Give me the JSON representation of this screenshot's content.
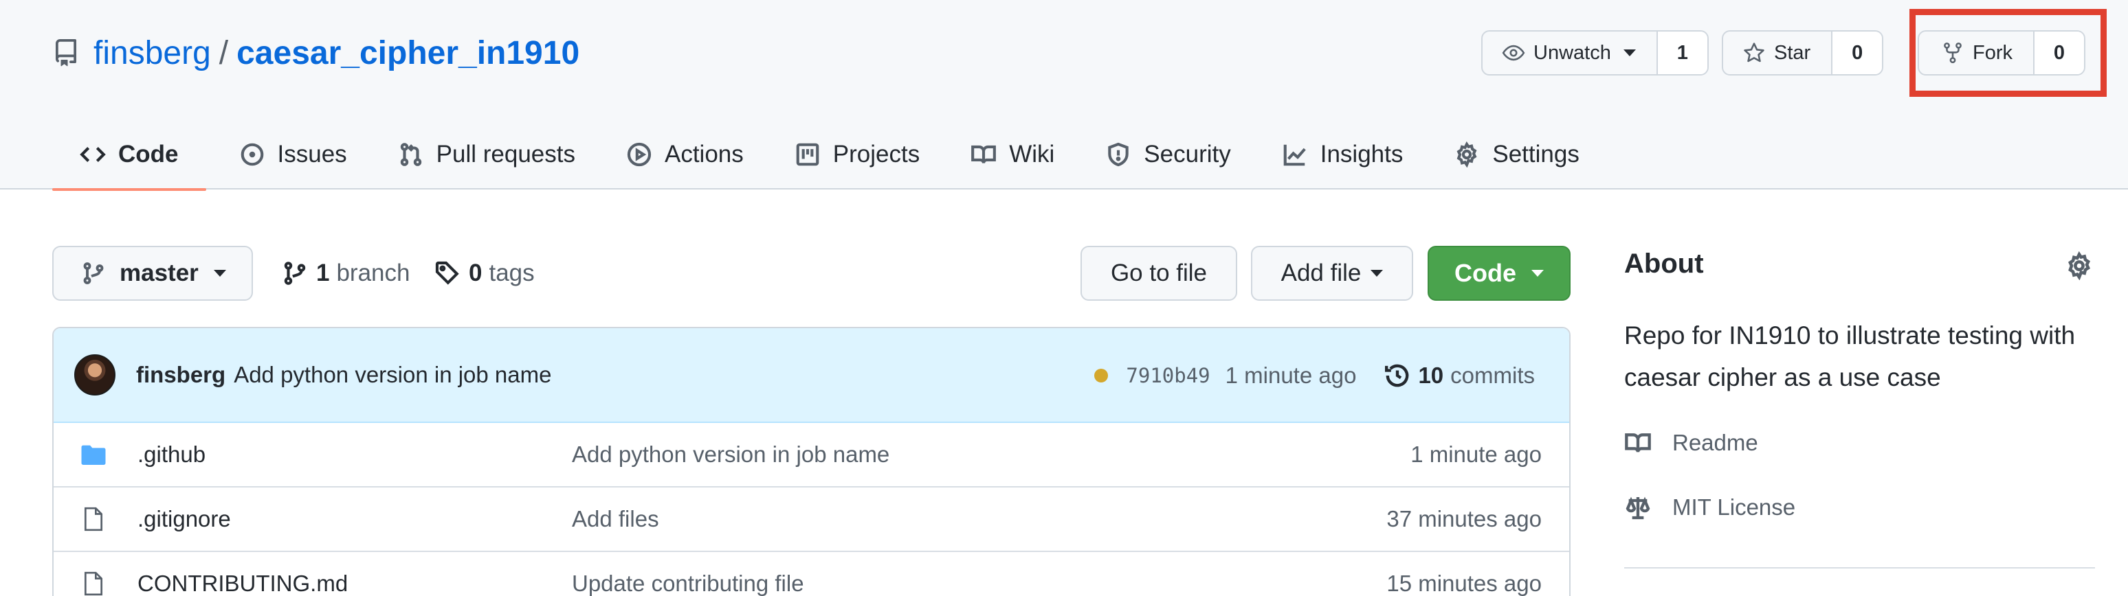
{
  "repo": {
    "owner": "finsberg",
    "separator": "/",
    "name": "caesar_cipher_in1910"
  },
  "header_actions": {
    "watch": {
      "label": "Unwatch",
      "count": "1"
    },
    "star": {
      "label": "Star",
      "count": "0"
    },
    "fork": {
      "label": "Fork",
      "count": "0"
    }
  },
  "highlight_color": "#e0402f",
  "tabs": [
    {
      "label": "Code",
      "icon": "code-icon",
      "selected": true
    },
    {
      "label": "Issues",
      "icon": "issue-icon"
    },
    {
      "label": "Pull requests",
      "icon": "pull-request-icon"
    },
    {
      "label": "Actions",
      "icon": "play-icon"
    },
    {
      "label": "Projects",
      "icon": "project-icon"
    },
    {
      "label": "Wiki",
      "icon": "book-icon"
    },
    {
      "label": "Security",
      "icon": "shield-icon"
    },
    {
      "label": "Insights",
      "icon": "graph-icon"
    },
    {
      "label": "Settings",
      "icon": "gear-icon"
    }
  ],
  "toolbar": {
    "branch": "master",
    "branch_count": "1",
    "branch_word": "branch",
    "tag_count": "0",
    "tag_word": "tags",
    "go_to_file": "Go to file",
    "add_file": "Add file",
    "code": "Code"
  },
  "latest_commit": {
    "author": "finsberg",
    "message": "Add python version in job name",
    "sha": "7910b49",
    "time": "1 minute ago",
    "commit_count": "10",
    "commit_word": "commits",
    "status_color": "#d4a72c"
  },
  "files": [
    {
      "name": ".github",
      "type": "folder",
      "message": "Add python version in job name",
      "time": "1 minute ago"
    },
    {
      "name": ".gitignore",
      "type": "file",
      "message": "Add files",
      "time": "37 minutes ago"
    },
    {
      "name": "CONTRIBUTING.md",
      "type": "file",
      "message": "Update contributing file",
      "time": "15 minutes ago"
    }
  ],
  "about": {
    "title": "About",
    "description": "Repo for IN1910 to illustrate testing with caesar cipher as a use case",
    "readme": "Readme",
    "license": "MIT License"
  },
  "colors": {
    "accent": "#0969da",
    "code_button": "#4aa34d",
    "tab_underline": "#fd8c73"
  }
}
